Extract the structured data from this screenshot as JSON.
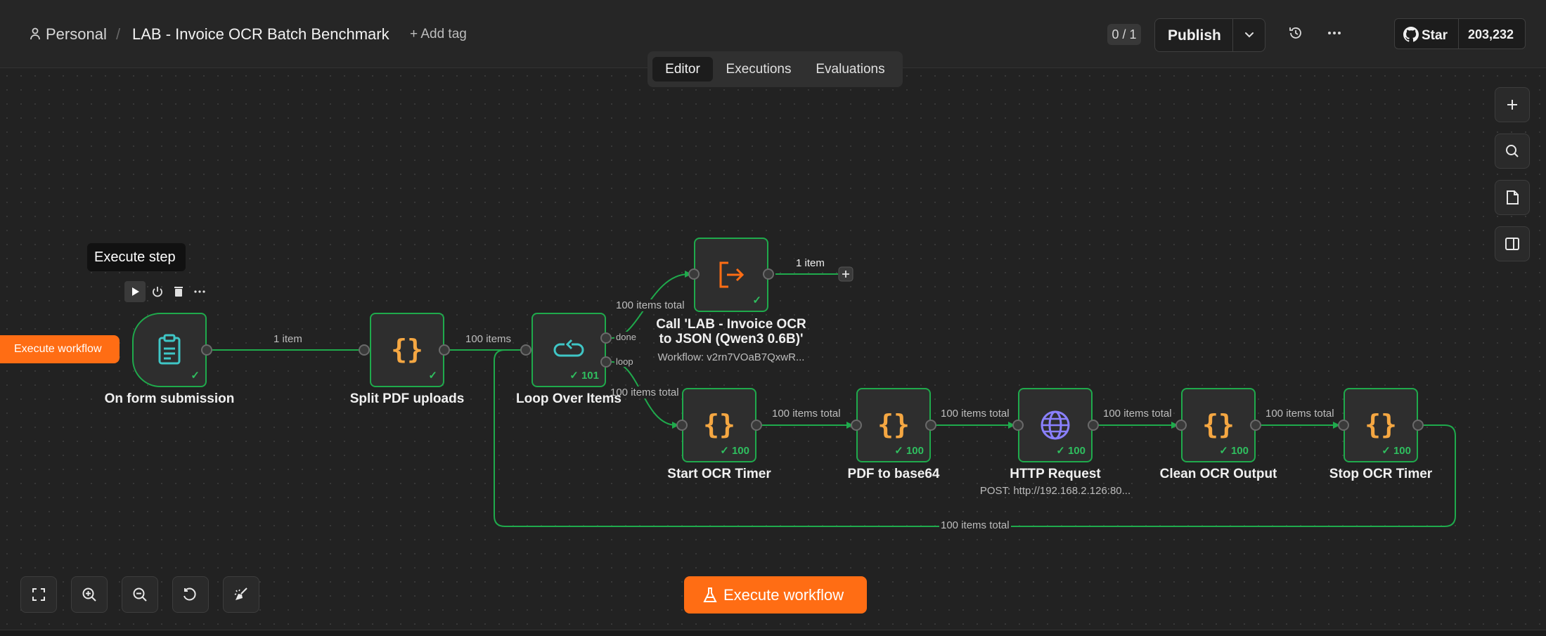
{
  "header": {
    "project": "Personal",
    "separator": "/",
    "workflow_title": "LAB - Invoice OCR Batch Benchmark",
    "add_tag": "+ Add tag",
    "counter": "0 / 1",
    "publish_label": "Publish",
    "github": {
      "star_label": "Star",
      "stars": "203,232"
    }
  },
  "tabs": [
    {
      "label": "Editor",
      "active": true
    },
    {
      "label": "Executions",
      "active": false
    },
    {
      "label": "Evaluations",
      "active": false
    }
  ],
  "tooltip": "Execute step",
  "execute_side_label": "Execute workflow",
  "execute_main_label": "Execute workflow",
  "nodes": {
    "form": {
      "label": "On form submission",
      "icon": "clipboard-icon"
    },
    "split": {
      "label": "Split PDF uploads",
      "icon": "code-braces-icon"
    },
    "loop": {
      "label": "Loop Over Items",
      "icon": "loop-icon",
      "badge": "101"
    },
    "call": {
      "label_line1": "Call 'LAB - Invoice OCR",
      "label_line2": "to JSON (Qwen3 0.6B)'",
      "sub": "Workflow: v2rn7VOaB7QxwR...",
      "icon": "sign-out-icon"
    },
    "start_timer": {
      "label": "Start OCR Timer",
      "badge": "100",
      "icon": "code-braces-icon"
    },
    "pdf64": {
      "label": "PDF to base64",
      "badge": "100",
      "icon": "code-braces-icon"
    },
    "http": {
      "label": "HTTP Request",
      "sub": "POST: http://192.168.2.126:80...",
      "badge": "100",
      "icon": "globe-icon"
    },
    "clean": {
      "label": "Clean OCR Output",
      "badge": "100",
      "icon": "code-braces-icon"
    },
    "stop_timer": {
      "label": "Stop OCR Timer",
      "badge": "100",
      "icon": "code-braces-icon"
    }
  },
  "edges": {
    "form_split": "1 item",
    "split_loop": "100 items",
    "loop_done": "100 items total",
    "done_port": "done",
    "loop_port": "loop",
    "loop_start": "100 items total",
    "call_out": "1 item",
    "start_pdf": "100 items total",
    "pdf_http": "100 items total",
    "http_clean": "100 items total",
    "clean_stop": "100 items total",
    "stop_back": "100 items total"
  },
  "colors": {
    "accent": "#ff6d14",
    "success": "#1faa4c",
    "code_icon": "#f5a742",
    "form_icon": "#3fc6c6",
    "http_icon": "#8a80ff",
    "call_icon": "#ff6d14"
  }
}
